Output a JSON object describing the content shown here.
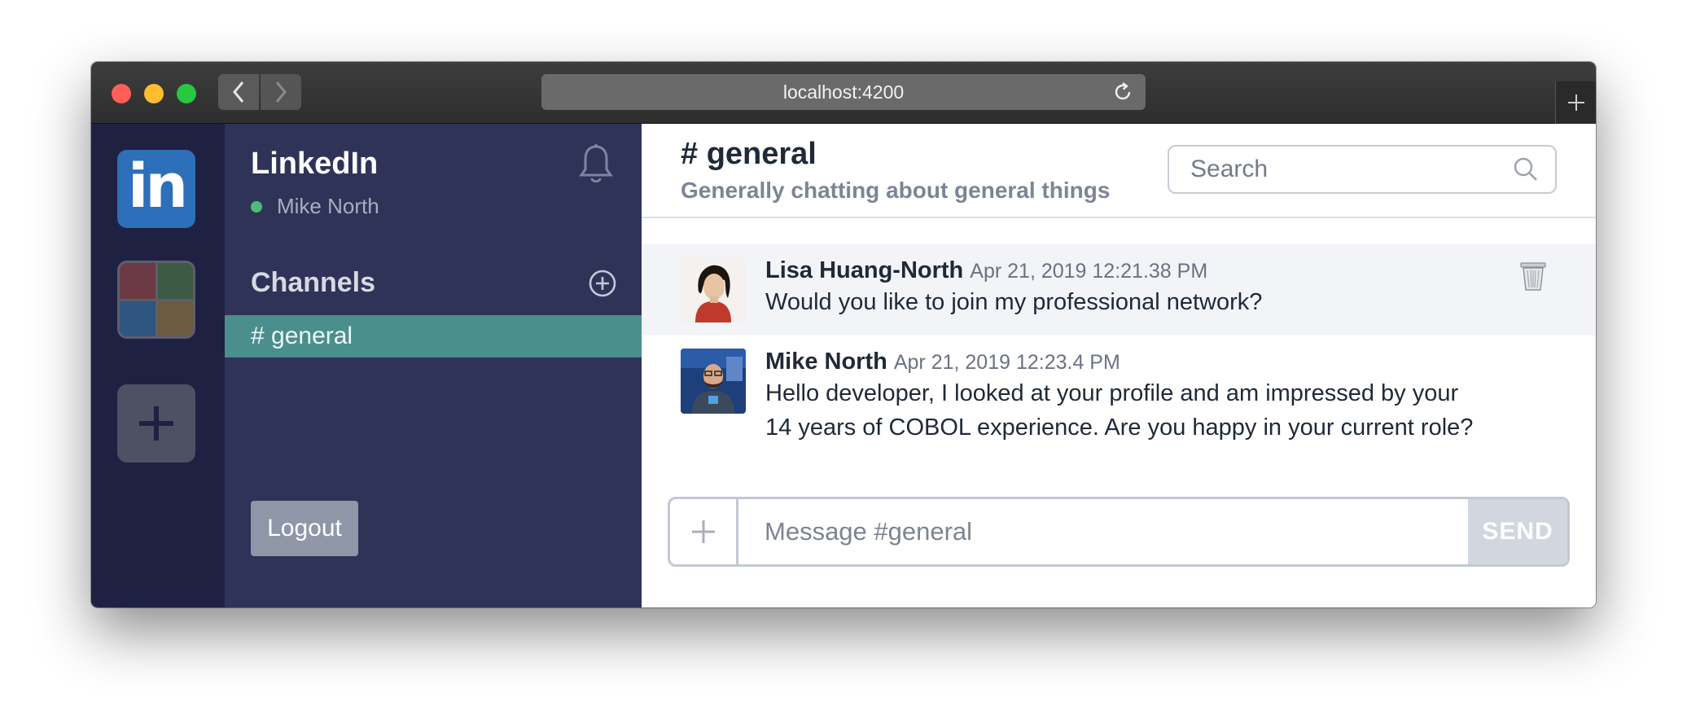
{
  "browser": {
    "url": "localhost:4200"
  },
  "teams": [
    {
      "name": "LinkedIn",
      "logo_text": "in",
      "color": "#2d6fb8"
    },
    {
      "name": "team-grid",
      "colors": [
        "#6b3a44",
        "#3d5a45",
        "#2f5680",
        "#6d5a40"
      ]
    }
  ],
  "sidebar": {
    "org_name": "LinkedIn",
    "user_name": "Mike North",
    "user_status_color": "#4dbd74",
    "channels_title": "Channels",
    "channels": [
      {
        "label": "# general",
        "active": true
      }
    ],
    "logout_label": "Logout"
  },
  "channel": {
    "name": "# general",
    "description": "Generally chatting about general things",
    "search_placeholder": "Search"
  },
  "messages": [
    {
      "author": "Lisa Huang-North",
      "timestamp": "Apr 21, 2019 12:21.38 PM",
      "text": "Would you like to join my professional network?"
    },
    {
      "author": "Mike North",
      "timestamp": "Apr 21, 2019 12:23.4 PM",
      "text": "Hello developer, I looked at your profile and am impressed by your 14 years of COBOL experience. Are you happy in your current role?"
    }
  ],
  "composer": {
    "placeholder": "Message #general",
    "send_label": "SEND"
  },
  "colors": {
    "rail": "#1e2142",
    "sidebar": "#2f3358",
    "active_channel": "#4a8f8c",
    "send_button": "#d2d6de"
  }
}
